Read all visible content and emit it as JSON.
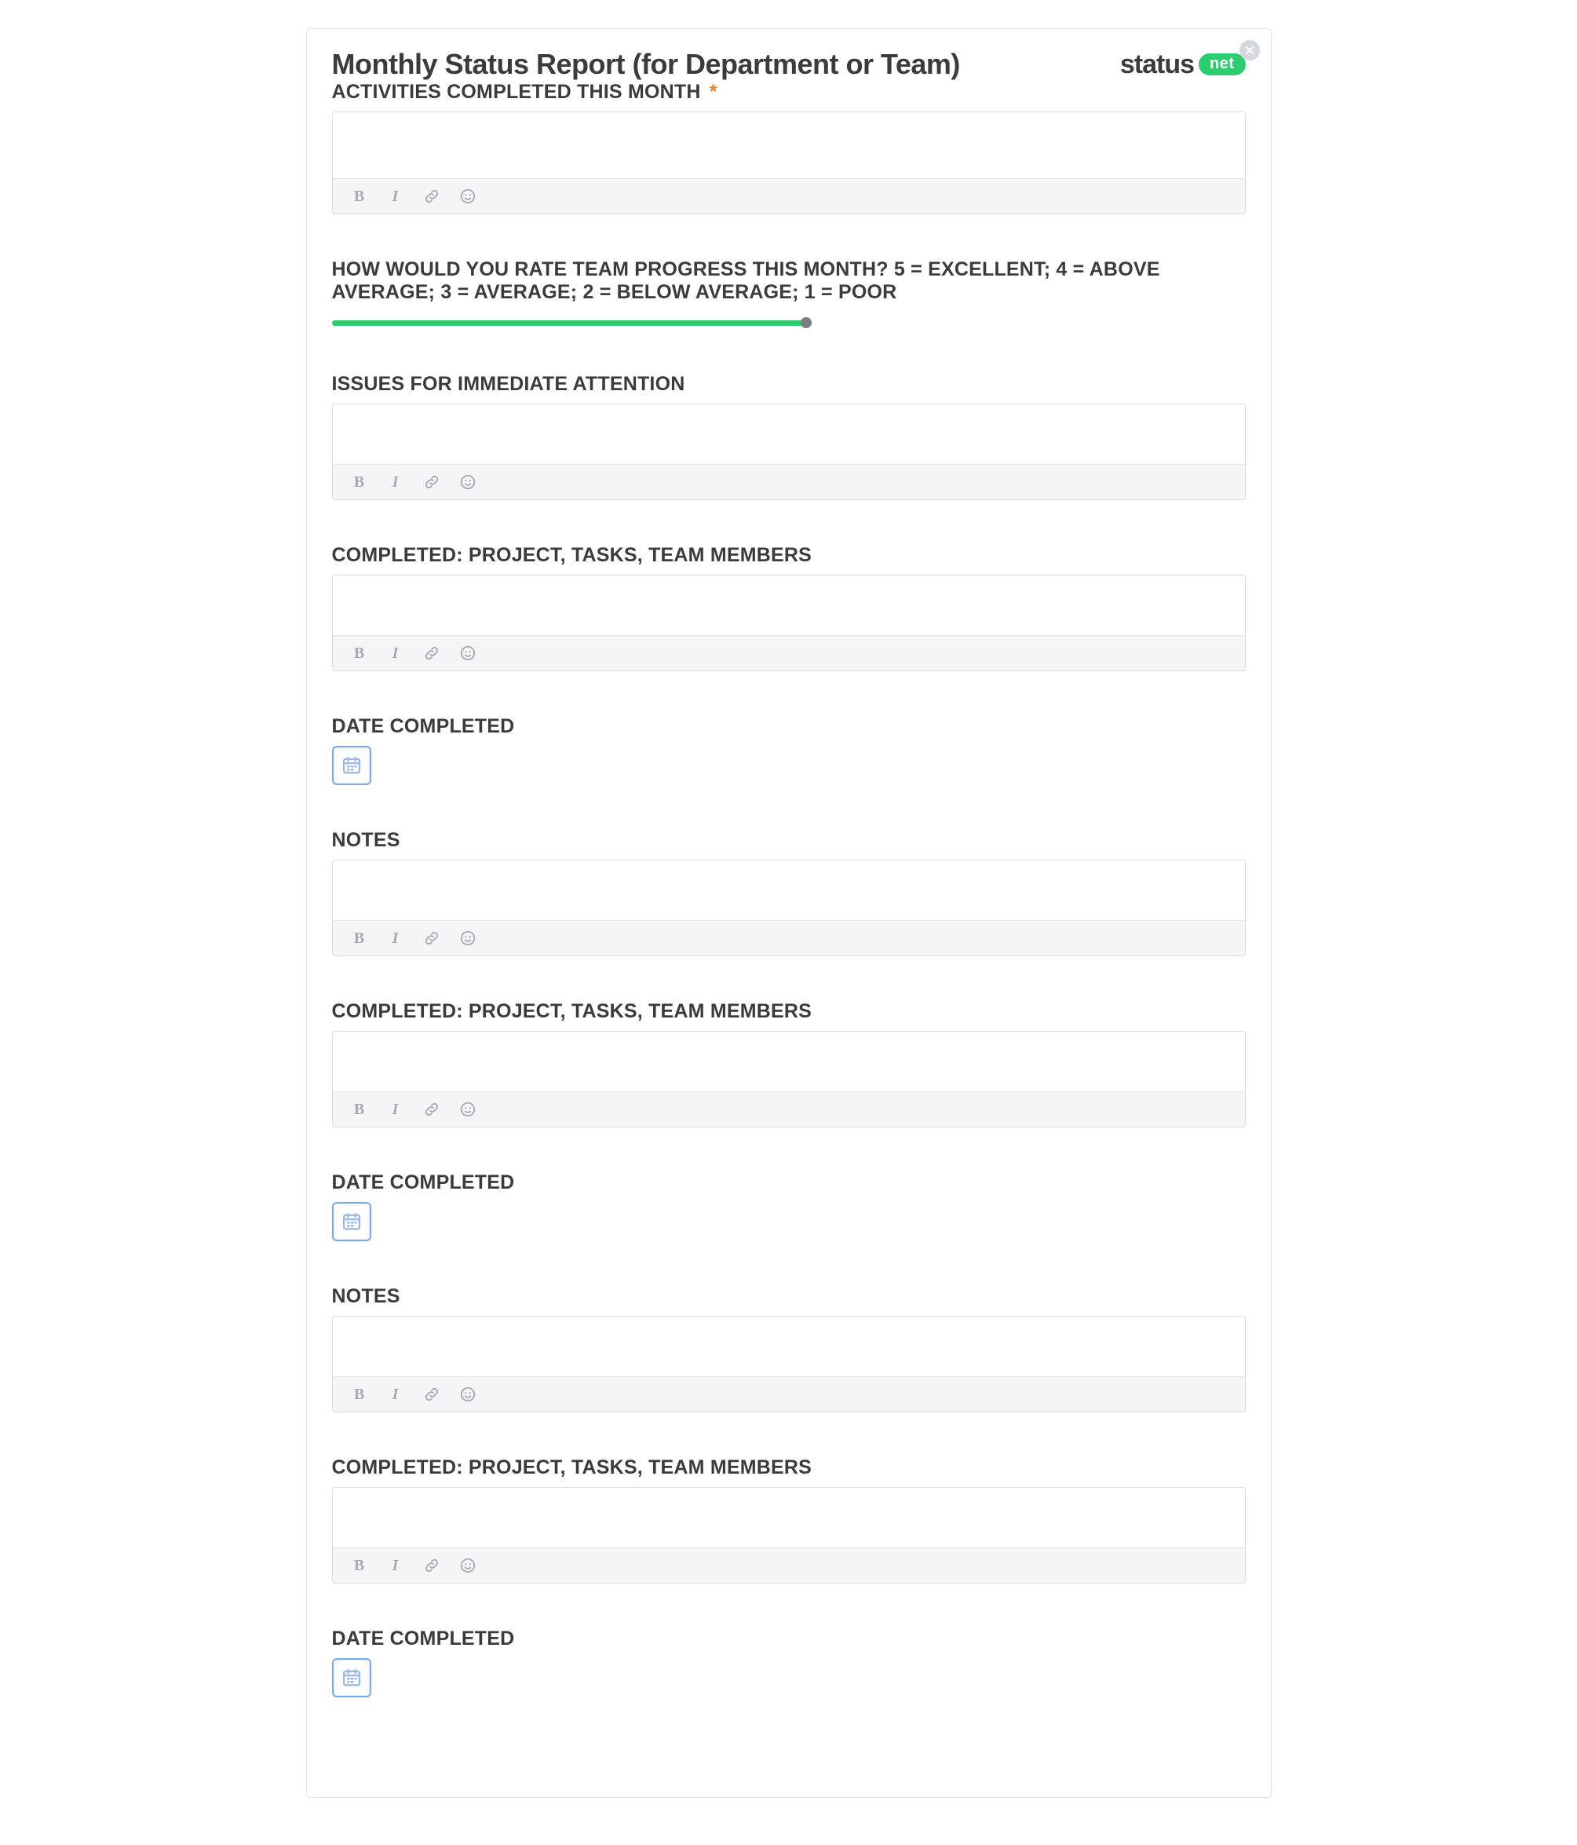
{
  "header": {
    "title": "Monthly Status Report (for Department or Team)",
    "brand_word": "status",
    "brand_pill": "net"
  },
  "sections": {
    "activities": {
      "label": "ACTIVITIES COMPLETED THIS MONTH",
      "required": true,
      "value": ""
    },
    "rating": {
      "label": "HOW WOULD YOU RATE TEAM PROGRESS THIS MONTH? 5 = EXCELLENT; 4 = ABOVE AVERAGE; 3 = AVERAGE; 2 = BELOW AVERAGE; 1 = POOR"
    },
    "issues": {
      "label": "ISSUES FOR IMMEDIATE ATTENTION",
      "value": ""
    },
    "completed1": {
      "label": "COMPLETED: PROJECT, TASKS, TEAM MEMBERS",
      "value": ""
    },
    "date1": {
      "label": "DATE COMPLETED"
    },
    "notes1": {
      "label": "NOTES",
      "value": ""
    },
    "completed2": {
      "label": "COMPLETED: PROJECT, TASKS, TEAM MEMBERS",
      "value": ""
    },
    "date2": {
      "label": "DATE COMPLETED"
    },
    "notes2": {
      "label": "NOTES",
      "value": ""
    },
    "completed3": {
      "label": "COMPLETED: PROJECT, TASKS, TEAM MEMBERS",
      "value": ""
    },
    "date3": {
      "label": "DATE COMPLETED"
    }
  },
  "toolbar": {
    "bold": "B",
    "italic": "I"
  },
  "required_star": "*"
}
